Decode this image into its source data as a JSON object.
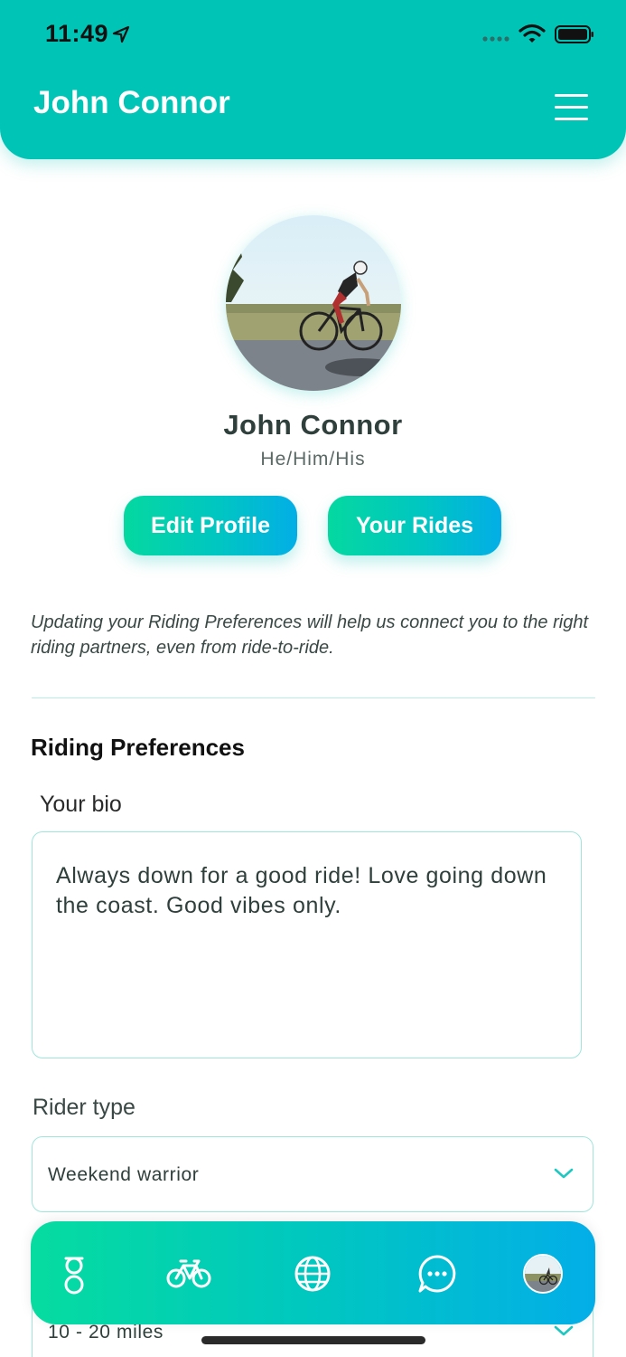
{
  "status_bar": {
    "time": "11:49",
    "icons": [
      "location-arrow-icon",
      "signal-icon",
      "wifi-icon",
      "battery-icon"
    ]
  },
  "header": {
    "title": "John Connor",
    "menu_icon": "hamburger-menu-icon",
    "background_color": "#00c4b6"
  },
  "profile": {
    "avatar_icon": "cyclist-photo",
    "name": "John Connor",
    "pronouns": "He/Him/His",
    "edit_profile_label": "Edit Profile",
    "your_rides_label": "Your Rides"
  },
  "info_note": "Updating your Riding Preferences will help us connect you to the right riding partners, even from ride-to-ride.",
  "preferences": {
    "section_title": "Riding Preferences",
    "bio": {
      "label": "Your bio",
      "value": "Always down for a good ride! Love going down the coast. Good vibes only."
    },
    "rider_type": {
      "label": "Rider type",
      "selected": "Weekend warrior"
    },
    "distance": {
      "selected": "10 - 20 miles"
    }
  },
  "tabbar": {
    "items": [
      {
        "icon": "app-logo-icon"
      },
      {
        "icon": "bicycle-icon"
      },
      {
        "icon": "globe-icon"
      },
      {
        "icon": "chat-bubble-icon"
      },
      {
        "icon": "profile-avatar-icon"
      }
    ]
  },
  "colors": {
    "accent": "#00c4b6",
    "gradient_start": "#05d8a0",
    "gradient_end": "#03aee6",
    "border": "#9fe5dc"
  }
}
